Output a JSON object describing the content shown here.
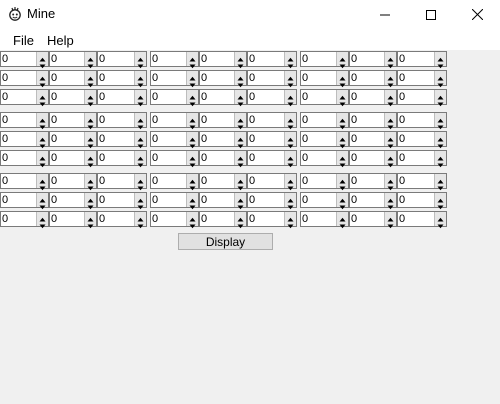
{
  "window": {
    "title": "Mine",
    "minimize_icon": "minimize-icon",
    "maximize_icon": "maximize-icon",
    "close_icon": "close-icon"
  },
  "menu": [
    {
      "label": "File"
    },
    {
      "label": "Help"
    }
  ],
  "grid": {
    "blocks": [
      [
        [
          "0",
          "0",
          "0",
          "0",
          "0",
          "0",
          "0",
          "0",
          "0"
        ],
        [
          "0",
          "0",
          "0",
          "0",
          "0",
          "0",
          "0",
          "0",
          "0"
        ],
        [
          "0",
          "0",
          "0",
          "0",
          "0",
          "0",
          "0",
          "0",
          "0"
        ]
      ],
      [
        [
          "0",
          "0",
          "0",
          "0",
          "0",
          "0",
          "0",
          "0",
          "0"
        ],
        [
          "0",
          "0",
          "0",
          "0",
          "0",
          "0",
          "0",
          "0",
          "0"
        ],
        [
          "0",
          "0",
          "0",
          "0",
          "0",
          "0",
          "0",
          "0",
          "0"
        ]
      ],
      [
        [
          "0",
          "0",
          "0",
          "0",
          "0",
          "0",
          "0",
          "0",
          "0"
        ],
        [
          "0",
          "0",
          "0",
          "0",
          "0",
          "0",
          "0",
          "0",
          "0"
        ],
        [
          "0",
          "0",
          "0",
          "0",
          "0",
          "0",
          "0",
          "0",
          "0"
        ]
      ]
    ]
  },
  "actions": {
    "display_label": "Display"
  }
}
